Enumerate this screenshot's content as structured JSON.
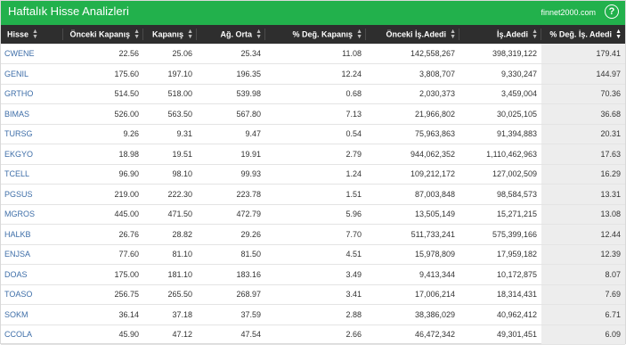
{
  "widget": {
    "title": "Haftalık Hisse Analizleri",
    "brand": "finnet2000.com",
    "help_icon": "?"
  },
  "columns": [
    "Hisse",
    "Önceki Kapanış",
    "Kapanış",
    "Ağ. Orta",
    "% Değ. Kapanış",
    "Önceki İş.Adedi",
    "İş.Adedi",
    "% Değ. İş. Adedi"
  ],
  "rows": [
    {
      "symbol": "CWENE",
      "prev_close": "22.56",
      "close": "25.06",
      "wavg": "25.34",
      "chg_close": "11.08",
      "prev_vol": "142,558,267",
      "vol": "398,319,122",
      "chg_vol": "179.41"
    },
    {
      "symbol": "GENIL",
      "prev_close": "175.60",
      "close": "197.10",
      "wavg": "196.35",
      "chg_close": "12.24",
      "prev_vol": "3,808,707",
      "vol": "9,330,247",
      "chg_vol": "144.97"
    },
    {
      "symbol": "GRTHO",
      "prev_close": "514.50",
      "close": "518.00",
      "wavg": "539.98",
      "chg_close": "0.68",
      "prev_vol": "2,030,373",
      "vol": "3,459,004",
      "chg_vol": "70.36"
    },
    {
      "symbol": "BIMAS",
      "prev_close": "526.00",
      "close": "563.50",
      "wavg": "567.80",
      "chg_close": "7.13",
      "prev_vol": "21,966,802",
      "vol": "30,025,105",
      "chg_vol": "36.68"
    },
    {
      "symbol": "TURSG",
      "prev_close": "9.26",
      "close": "9.31",
      "wavg": "9.47",
      "chg_close": "0.54",
      "prev_vol": "75,963,863",
      "vol": "91,394,883",
      "chg_vol": "20.31"
    },
    {
      "symbol": "EKGYO",
      "prev_close": "18.98",
      "close": "19.51",
      "wavg": "19.91",
      "chg_close": "2.79",
      "prev_vol": "944,062,352",
      "vol": "1,110,462,963",
      "chg_vol": "17.63"
    },
    {
      "symbol": "TCELL",
      "prev_close": "96.90",
      "close": "98.10",
      "wavg": "99.93",
      "chg_close": "1.24",
      "prev_vol": "109,212,172",
      "vol": "127,002,509",
      "chg_vol": "16.29"
    },
    {
      "symbol": "PGSUS",
      "prev_close": "219.00",
      "close": "222.30",
      "wavg": "223.78",
      "chg_close": "1.51",
      "prev_vol": "87,003,848",
      "vol": "98,584,573",
      "chg_vol": "13.31"
    },
    {
      "symbol": "MGROS",
      "prev_close": "445.00",
      "close": "471.50",
      "wavg": "472.79",
      "chg_close": "5.96",
      "prev_vol": "13,505,149",
      "vol": "15,271,215",
      "chg_vol": "13.08"
    },
    {
      "symbol": "HALKB",
      "prev_close": "26.76",
      "close": "28.82",
      "wavg": "29.26",
      "chg_close": "7.70",
      "prev_vol": "511,733,241",
      "vol": "575,399,166",
      "chg_vol": "12.44"
    },
    {
      "symbol": "ENJSA",
      "prev_close": "77.60",
      "close": "81.10",
      "wavg": "81.50",
      "chg_close": "4.51",
      "prev_vol": "15,978,809",
      "vol": "17,959,182",
      "chg_vol": "12.39"
    },
    {
      "symbol": "DOAS",
      "prev_close": "175.00",
      "close": "181.10",
      "wavg": "183.16",
      "chg_close": "3.49",
      "prev_vol": "9,413,344",
      "vol": "10,172,875",
      "chg_vol": "8.07"
    },
    {
      "symbol": "TOASO",
      "prev_close": "256.75",
      "close": "265.50",
      "wavg": "268.97",
      "chg_close": "3.41",
      "prev_vol": "17,006,214",
      "vol": "18,314,431",
      "chg_vol": "7.69"
    },
    {
      "symbol": "SOKM",
      "prev_close": "36.14",
      "close": "37.18",
      "wavg": "37.59",
      "chg_close": "2.88",
      "prev_vol": "38,386,029",
      "vol": "40,962,412",
      "chg_vol": "6.71"
    },
    {
      "symbol": "CCOLA",
      "prev_close": "45.90",
      "close": "47.12",
      "wavg": "47.54",
      "chg_close": "2.66",
      "prev_vol": "46,472,342",
      "vol": "49,301,451",
      "chg_vol": "6.09"
    }
  ],
  "colors": {
    "header_green": "#22b14c",
    "column_header_bg": "#2e2e2e",
    "symbol_link": "#3e6ea8",
    "sorted_column_bg": "#ededed"
  }
}
